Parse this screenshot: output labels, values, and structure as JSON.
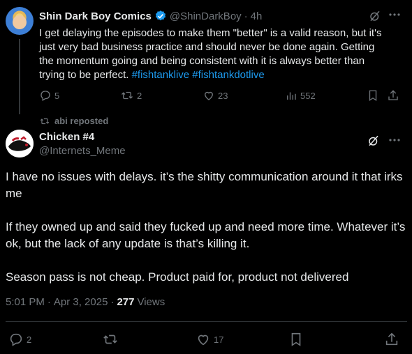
{
  "parent_tweet": {
    "author_name": "Shin Dark Boy Comics",
    "handle": "@ShinDarkBoy",
    "separator": "·",
    "time": "4h",
    "body_text": "I get delaying the episodes to make them \"better\" is a valid reason, but it's just very bad business practice and should never be done again. Getting the momentum going and being consistent with it is always better than trying to be perfect.",
    "hashtags": [
      "#fishtanklive",
      "#fishtankdotlive"
    ],
    "replies": "5",
    "reposts": "2",
    "likes": "23",
    "views": "552",
    "verified_color": "#1d9bf0"
  },
  "repost_banner": {
    "text": "abi reposted"
  },
  "main_tweet": {
    "author_name": "Chicken #4",
    "handle": "@Internets_Meme",
    "paragraphs": [
      "I have no issues with delays. it’s the shitty communication around it that irks me",
      "If they owned up and said they fucked up and need more time. Whatever it’s ok, but the lack of any update is that’s  killing it.",
      "Season pass is not cheap. Product paid for, product not delivered"
    ],
    "time": "5:01 PM",
    "date": "Apr 3, 2025",
    "dot": "·",
    "views_count": "277",
    "views_label": "Views",
    "replies": "2",
    "likes": "17"
  },
  "colors": {
    "background": "#000000",
    "text": "#e7e9ea",
    "muted": "#71767b",
    "link": "#1d9bf0"
  }
}
